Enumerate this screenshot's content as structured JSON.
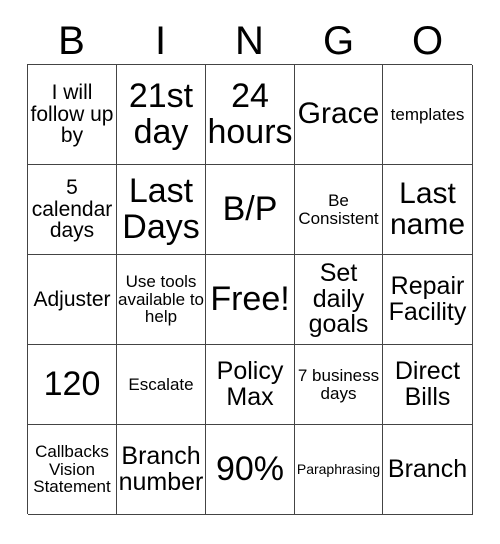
{
  "header": {
    "letters": [
      "B",
      "I",
      "N",
      "G",
      "O"
    ]
  },
  "grid": {
    "rows": [
      [
        {
          "text": "I will follow up by",
          "size": "s-sm"
        },
        {
          "text": "21st day",
          "size": "s-xl"
        },
        {
          "text": "24 hours",
          "size": "s-xl"
        },
        {
          "text": "Grace",
          "size": "s-lg"
        },
        {
          "text": "templates",
          "size": "s-xs"
        }
      ],
      [
        {
          "text": "5 calendar days",
          "size": "s-sm"
        },
        {
          "text": "Last Days",
          "size": "s-xl"
        },
        {
          "text": "B/P",
          "size": "s-xl"
        },
        {
          "text": "Be Consistent",
          "size": "s-xs"
        },
        {
          "text": "Last name",
          "size": "s-lg"
        }
      ],
      [
        {
          "text": "Adjuster",
          "size": "s-sm"
        },
        {
          "text": "Use tools available to help",
          "size": "s-xs"
        },
        {
          "text": "Free!",
          "size": "s-xl"
        },
        {
          "text": "Set daily goals",
          "size": "s-md"
        },
        {
          "text": "Repair Facility",
          "size": "s-md"
        }
      ],
      [
        {
          "text": "120",
          "size": "s-xl"
        },
        {
          "text": "Escalate",
          "size": "s-xs"
        },
        {
          "text": "Policy Max",
          "size": "s-md"
        },
        {
          "text": "7 business days",
          "size": "s-xs"
        },
        {
          "text": "Direct Bills",
          "size": "s-md"
        }
      ],
      [
        {
          "text": "Callbacks Vision Statement",
          "size": "s-xs"
        },
        {
          "text": "Branch number",
          "size": "s-md"
        },
        {
          "text": "90%",
          "size": "s-xl"
        },
        {
          "text": "Paraphrasing",
          "size": "s-xxs"
        },
        {
          "text": "Branch",
          "size": "s-md"
        }
      ]
    ]
  },
  "colors": {
    "border": "#444444",
    "text": "#000000",
    "background": "#ffffff"
  }
}
